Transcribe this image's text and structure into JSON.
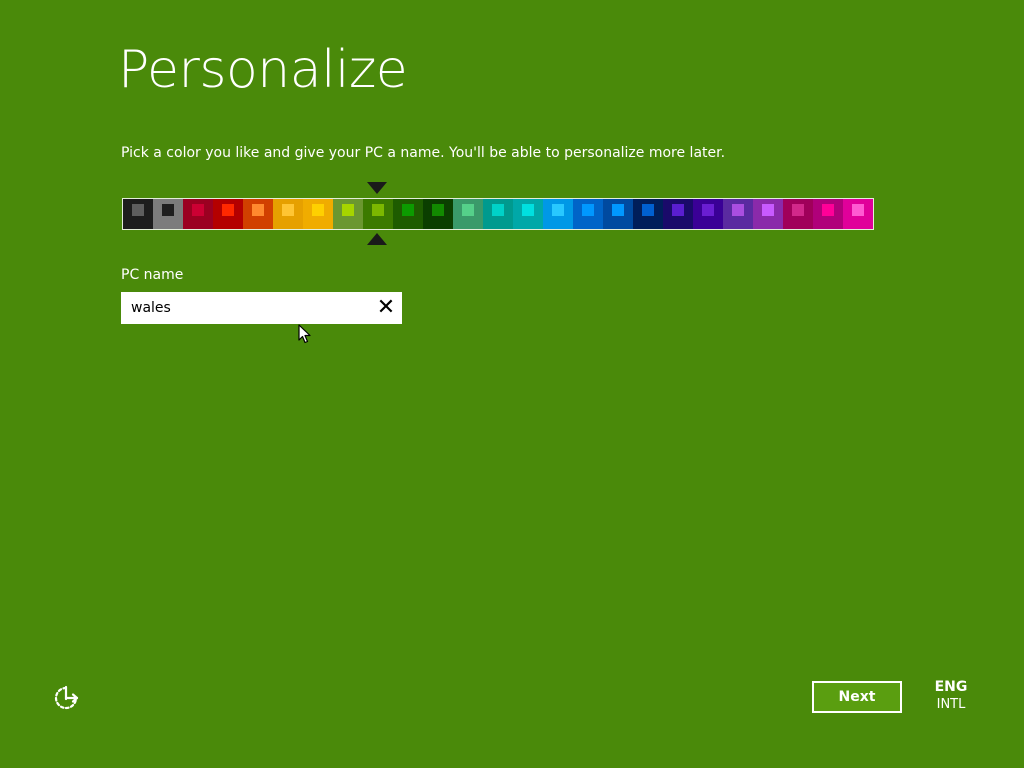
{
  "colors": {
    "background": "#4a8a0a",
    "next_button_bg": "#5a9e10"
  },
  "header": {
    "title": "Personalize",
    "subtitle": "Pick a color you like and give your PC a name. You'll be able to personalize more later."
  },
  "color_picker": {
    "selected_index": 8,
    "swatches": [
      {
        "base": "#1d1d1d",
        "accent": "#5e5e5e"
      },
      {
        "base": "#7c7c7c",
        "accent": "#1f1f1f"
      },
      {
        "base": "#9b0021",
        "accent": "#cc0033"
      },
      {
        "base": "#b40000",
        "accent": "#ff2800"
      },
      {
        "base": "#d14000",
        "accent": "#ff8a2e"
      },
      {
        "base": "#e6a000",
        "accent": "#ffc533"
      },
      {
        "base": "#f0ac00",
        "accent": "#ffd000"
      },
      {
        "base": "#6b9730",
        "accent": "#a6d400"
      },
      {
        "base": "#3c7a00",
        "accent": "#7cb800"
      },
      {
        "base": "#1e5c00",
        "accent": "#0c9b00"
      },
      {
        "base": "#0b3f00",
        "accent": "#128a00"
      },
      {
        "base": "#3a9a6a",
        "accent": "#55d08a"
      },
      {
        "base": "#009a8e",
        "accent": "#00d2c8"
      },
      {
        "base": "#00a8a8",
        "accent": "#00e0e0"
      },
      {
        "base": "#0098e6",
        "accent": "#28c8ff"
      },
      {
        "base": "#0064c8",
        "accent": "#0098ff"
      },
      {
        "base": "#004aa0",
        "accent": "#0098ff"
      },
      {
        "base": "#001e5a",
        "accent": "#0060d0"
      },
      {
        "base": "#1a0a6a",
        "accent": "#5a1ed0"
      },
      {
        "base": "#3a0096",
        "accent": "#6a1ed2"
      },
      {
        "base": "#5a2aa0",
        "accent": "#aa4ee0"
      },
      {
        "base": "#8a2aaa",
        "accent": "#c85aff"
      },
      {
        "base": "#a0005a",
        "accent": "#d2288a"
      },
      {
        "base": "#b0007a",
        "accent": "#ff0098"
      },
      {
        "base": "#e0009a",
        "accent": "#ff5ad2"
      }
    ]
  },
  "pc_name": {
    "label": "PC name",
    "value": "wales",
    "clear_glyph": "✕"
  },
  "footer": {
    "ease_of_access_icon": "ease-of-access-icon",
    "next_label": "Next",
    "language_code": "ENG",
    "keyboard_layout": "INTL"
  }
}
